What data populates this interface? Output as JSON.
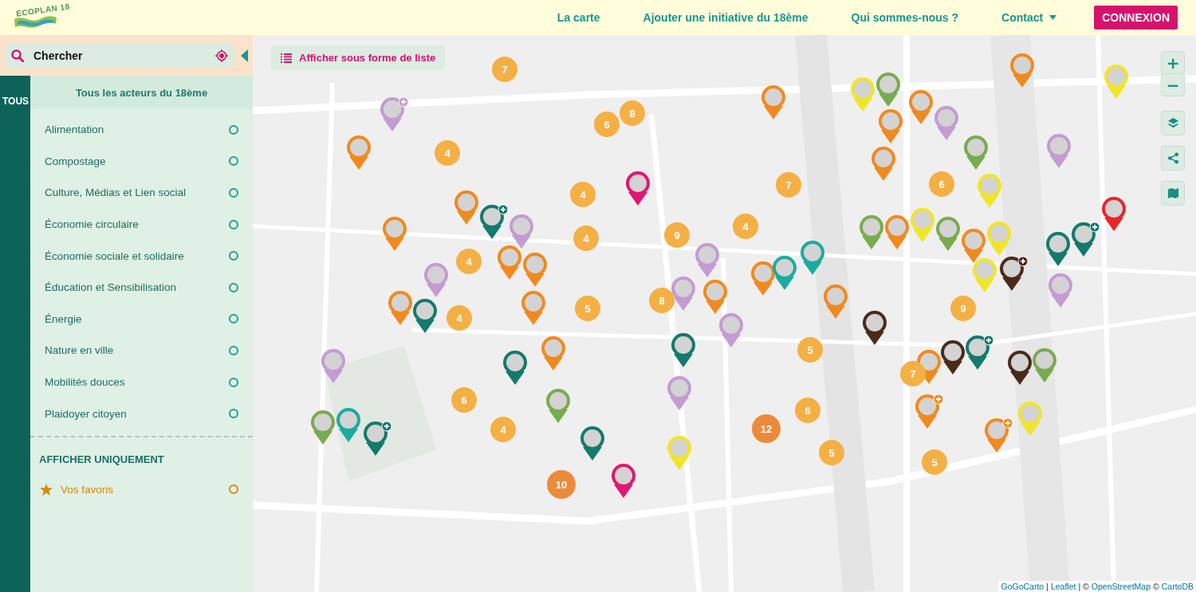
{
  "header": {
    "logo": "ECOPLAN 18",
    "nav": [
      {
        "label": "La carte",
        "dropdown": false
      },
      {
        "label": "Ajouter une initiative du 18ème",
        "dropdown": false
      },
      {
        "label": "Qui sommes-nous ?",
        "dropdown": false
      },
      {
        "label": "Contact",
        "dropdown": true
      }
    ],
    "login_button": "CONNEXION"
  },
  "sidebar": {
    "search": {
      "placeholder": "Chercher"
    },
    "tab": "TOUS",
    "heading": "Tous les acteurs du 18ème",
    "categories": [
      {
        "label": "Alimentation",
        "checked": false
      },
      {
        "label": "Compostage",
        "checked": false
      },
      {
        "label": "Culture, Médias et Lien social",
        "checked": false
      },
      {
        "label": "Économie circulaire",
        "checked": false
      },
      {
        "label": "Économie sociale et solidaire",
        "checked": false
      },
      {
        "label": "Éducation et Sensibilisation",
        "checked": false
      },
      {
        "label": "Énergie",
        "checked": false
      },
      {
        "label": "Nature en ville",
        "checked": false
      },
      {
        "label": "Mobilités douces",
        "checked": false
      },
      {
        "label": "Plaidoyer citoyen",
        "checked": false
      }
    ],
    "filter_heading": "AFFICHER UNIQUEMENT",
    "favorites": {
      "label": "Vos favoris",
      "checked": false
    }
  },
  "map": {
    "list_button": "Afficher sous forme de liste",
    "zoom_in": "+",
    "zoom_out": "−",
    "clusters": [
      {
        "count": "7",
        "color": "#f4b045"
      },
      {
        "count": "8",
        "color": "#f4b045"
      },
      {
        "count": "6",
        "color": "#f4b045"
      },
      {
        "count": "4",
        "color": "#f4b045"
      },
      {
        "count": "4",
        "color": "#f4b045"
      },
      {
        "count": "7",
        "color": "#f4b045"
      },
      {
        "count": "6",
        "color": "#f4b045"
      },
      {
        "count": "9",
        "color": "#f4b045"
      },
      {
        "count": "4",
        "color": "#f4b045"
      },
      {
        "count": "4",
        "color": "#f4b045"
      },
      {
        "count": "4",
        "color": "#f4b045"
      },
      {
        "count": "8",
        "color": "#f4b045"
      },
      {
        "count": "5",
        "color": "#f4b045"
      },
      {
        "count": "4",
        "color": "#f4b045"
      },
      {
        "count": "9",
        "color": "#f4b045"
      },
      {
        "count": "5",
        "color": "#f4b045"
      },
      {
        "count": "7",
        "color": "#f4b045"
      },
      {
        "count": "6",
        "color": "#f4b045"
      },
      {
        "count": "6",
        "color": "#f4b045"
      },
      {
        "count": "4",
        "color": "#f4b045"
      },
      {
        "count": "12",
        "color": "#ec8a3c"
      },
      {
        "count": "5",
        "color": "#f4b045"
      },
      {
        "count": "5",
        "color": "#f4b045"
      },
      {
        "count": "10",
        "color": "#ec8a3c"
      }
    ],
    "markers": [
      {
        "color": "#c49bd2",
        "plus": true
      },
      {
        "color": "#f08a1f",
        "plus": false
      },
      {
        "color": "#f08a1f",
        "plus": false
      },
      {
        "color": "#137a6c",
        "plus": true
      },
      {
        "color": "#c49bd2",
        "plus": false
      },
      {
        "color": "#e0186f",
        "plus": false
      },
      {
        "color": "#f08a1f",
        "plus": false
      },
      {
        "color": "#c49bd2",
        "plus": false
      },
      {
        "color": "#f08a1f",
        "plus": false
      },
      {
        "color": "#f08a1f",
        "plus": false
      },
      {
        "color": "#f08a1f",
        "plus": false
      },
      {
        "color": "#f08a1f",
        "plus": false
      },
      {
        "color": "#137a6c",
        "plus": false
      },
      {
        "color": "#c49bd2",
        "plus": false
      },
      {
        "color": "#137a6c",
        "plus": false
      },
      {
        "color": "#f08a1f",
        "plus": false
      },
      {
        "color": "#7aab4e",
        "plus": false
      },
      {
        "color": "#7aab4e",
        "plus": false
      },
      {
        "color": "#1aaba0",
        "plus": false
      },
      {
        "color": "#137a6c",
        "plus": true
      },
      {
        "color": "#137a6c",
        "plus": false
      },
      {
        "color": "#e0186f",
        "plus": false
      },
      {
        "color": "#f1e52a",
        "plus": false
      },
      {
        "color": "#c49bd2",
        "plus": false
      },
      {
        "color": "#137a6c",
        "plus": false
      },
      {
        "color": "#c49bd2",
        "plus": false
      },
      {
        "color": "#c49bd2",
        "plus": false
      },
      {
        "color": "#f08a1f",
        "plus": false
      },
      {
        "color": "#c49bd2",
        "plus": false
      },
      {
        "color": "#f08a1f",
        "plus": false
      },
      {
        "color": "#f08a1f",
        "plus": false
      },
      {
        "color": "#1aaba0",
        "plus": false
      },
      {
        "color": "#1aaba0",
        "plus": false
      },
      {
        "color": "#f08a1f",
        "plus": false
      },
      {
        "color": "#4a2a1a",
        "plus": false
      },
      {
        "color": "#f1e52a",
        "plus": false
      },
      {
        "color": "#7aab4e",
        "plus": false
      },
      {
        "color": "#f08a1f",
        "plus": false
      },
      {
        "color": "#f08a1f",
        "plus": false
      },
      {
        "color": "#c49bd2",
        "plus": false
      },
      {
        "color": "#f08a1f",
        "plus": false
      },
      {
        "color": "#f08a1f",
        "plus": false
      },
      {
        "color": "#f1e52a",
        "plus": false
      },
      {
        "color": "#c49bd2",
        "plus": false
      },
      {
        "color": "#7aab4e",
        "plus": false
      },
      {
        "color": "#f1e52a",
        "plus": false
      },
      {
        "color": "#f1e52a",
        "plus": false
      },
      {
        "color": "#7aab4e",
        "plus": false
      },
      {
        "color": "#f08a1f",
        "plus": false
      },
      {
        "color": "#7aab4e",
        "plus": false
      },
      {
        "color": "#f08a1f",
        "plus": false
      },
      {
        "color": "#f1e52a",
        "plus": false
      },
      {
        "color": "#e8262a",
        "plus": false
      },
      {
        "color": "#137a6c",
        "plus": true
      },
      {
        "color": "#137a6c",
        "plus": false
      },
      {
        "color": "#f1e52a",
        "plus": false
      },
      {
        "color": "#4a2a1a",
        "plus": true
      },
      {
        "color": "#c49bd2",
        "plus": false
      },
      {
        "color": "#f08a1f",
        "plus": false
      },
      {
        "color": "#4a2a1a",
        "plus": false
      },
      {
        "color": "#137a6c",
        "plus": true
      },
      {
        "color": "#4a2a1a",
        "plus": false
      },
      {
        "color": "#7aab4e",
        "plus": false
      },
      {
        "color": "#f08a1f",
        "plus": true
      },
      {
        "color": "#f1e52a",
        "plus": false
      },
      {
        "color": "#f08a1f",
        "plus": true
      }
    ],
    "attribution": [
      {
        "text": "GoGoCarto",
        "kind": "link"
      },
      {
        "text": "|",
        "kind": "text"
      },
      {
        "text": "Leaflet",
        "kind": "link"
      },
      {
        "text": "| ©",
        "kind": "text"
      },
      {
        "text": "OpenStreetMap",
        "kind": "link"
      },
      {
        "text": "©",
        "kind": "text"
      },
      {
        "text": "CartoDB",
        "kind": "link"
      }
    ]
  }
}
